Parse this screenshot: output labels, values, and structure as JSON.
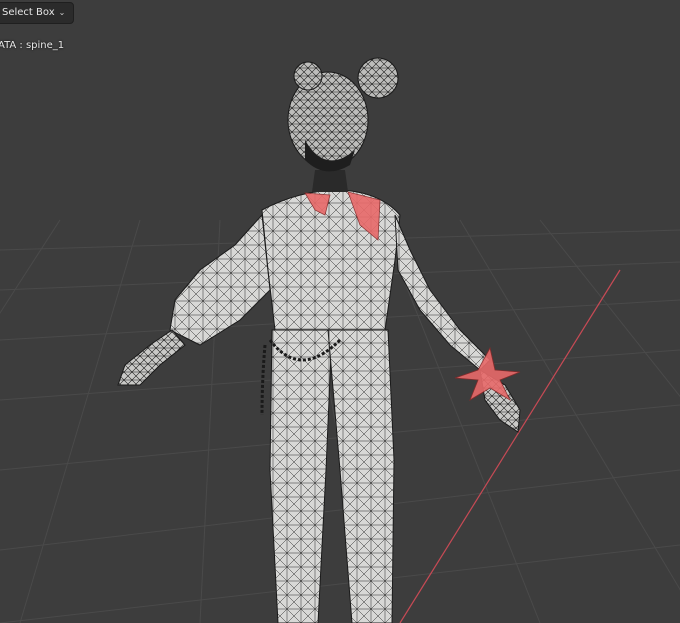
{
  "toolbar": {
    "select_mode_label": "Select Box",
    "select_mode_icon": "chevron-down-icon"
  },
  "viewport": {
    "object_label": "ATA : spine_1",
    "background": "#3d3d3d",
    "grid_line": "#4a4a4a",
    "x_axis_color": "#c74a55"
  },
  "mesh": {
    "fill": "#d8d8d6",
    "wire": "#1a1a1a",
    "selection_color": "#e86a6a"
  }
}
